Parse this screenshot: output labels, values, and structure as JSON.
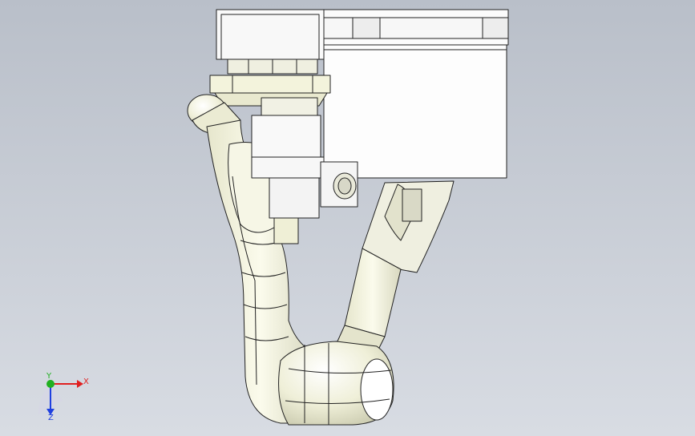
{
  "viewport": {
    "background_top": "#b9bfc9",
    "background_bottom": "#d8dce3",
    "part_fill": "#f4f4e2",
    "part_shade": "#dcdcc4",
    "edge_color": "#222222",
    "bracket_fill": "#fbfbfb"
  },
  "triad": {
    "x_label": "X",
    "y_label": "Y",
    "z_label": "Z",
    "x_color": "#e02020",
    "y_color": "#20b020",
    "z_color": "#2040e0"
  }
}
